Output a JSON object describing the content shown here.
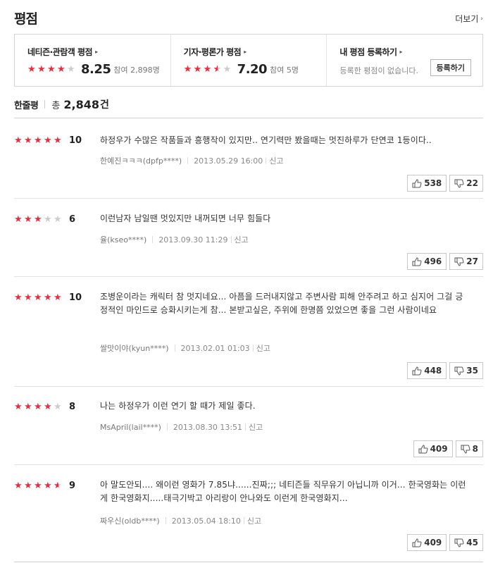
{
  "header": {
    "title": "평점",
    "more_label": "더보기"
  },
  "scores": {
    "netizen": {
      "label": "네티즌·관람객 평점",
      "value": "8.25",
      "participants": "참여 2,898명",
      "stars": 4.0
    },
    "critic": {
      "label": "기자·평론가 평점",
      "value": "7.20",
      "participants": "참여 5명",
      "stars": 3.5
    },
    "mine": {
      "label": "내 평점 등록하기",
      "empty_text": "등록한 평점이 없습니다.",
      "button": "등록하기"
    }
  },
  "comments": {
    "title": "한줄평",
    "total_label": "총",
    "count": "2,848",
    "unit": "건"
  },
  "reviews": [
    {
      "stars": 5,
      "score": "10",
      "text": "하정우가 수많은 작품들과 흥행작이 있지만.. 연기력만 봤을때는 멋진하루가 단연코 1등이다..",
      "author": "한예진ㅋㅋㅋ(dpfp****)",
      "date": "2013.05.29 16:00",
      "report": "신고",
      "likes": "538",
      "dislikes": "22"
    },
    {
      "stars": 3,
      "score": "6",
      "text": "이런남자 남일땐 멋있지만 내꺼되면 너무 힘들다",
      "author": "율(kseo****)",
      "date": "2013.09.30 11:29",
      "report": "신고",
      "likes": "496",
      "dislikes": "27"
    },
    {
      "stars": 5,
      "score": "10",
      "text": "조병운이라는 캐릭터 참 멋지네요... 아픔을 드러내지않고 주변사람 피해 안주려고 하고 심지어 그걸 긍정적인 마인드로 승화시키는게 참... 본받고싶은, 주위에 한명쯤 있었으면 좋을 그런 사람이네요",
      "author": "쌀맛이야(kyun****)",
      "date": "2013.02.01 01:03",
      "report": "신고",
      "likes": "448",
      "dislikes": "35"
    },
    {
      "stars": 4,
      "score": "8",
      "text": "나는 하정우가 이런 연기 할 때가 제일 좋다.",
      "author": "MsApril(lail****)",
      "date": "2013.08.30 13:51",
      "report": "신고",
      "likes": "409",
      "dislikes": "8"
    },
    {
      "stars": 4.5,
      "score": "9",
      "text": "아 말도안되.... 왜이런 영화가 7.85냐......진짜;;; 네티즌들 직무유기 아닙니까 이거... 한국영화는 이런게 한국영화지.....태극기박고 아리랑이 안나와도 이런게 한국영화지...",
      "author": "짜우신(oldb****)",
      "date": "2013.05.04 18:10",
      "report": "신고",
      "likes": "409",
      "dislikes": "45"
    }
  ]
}
